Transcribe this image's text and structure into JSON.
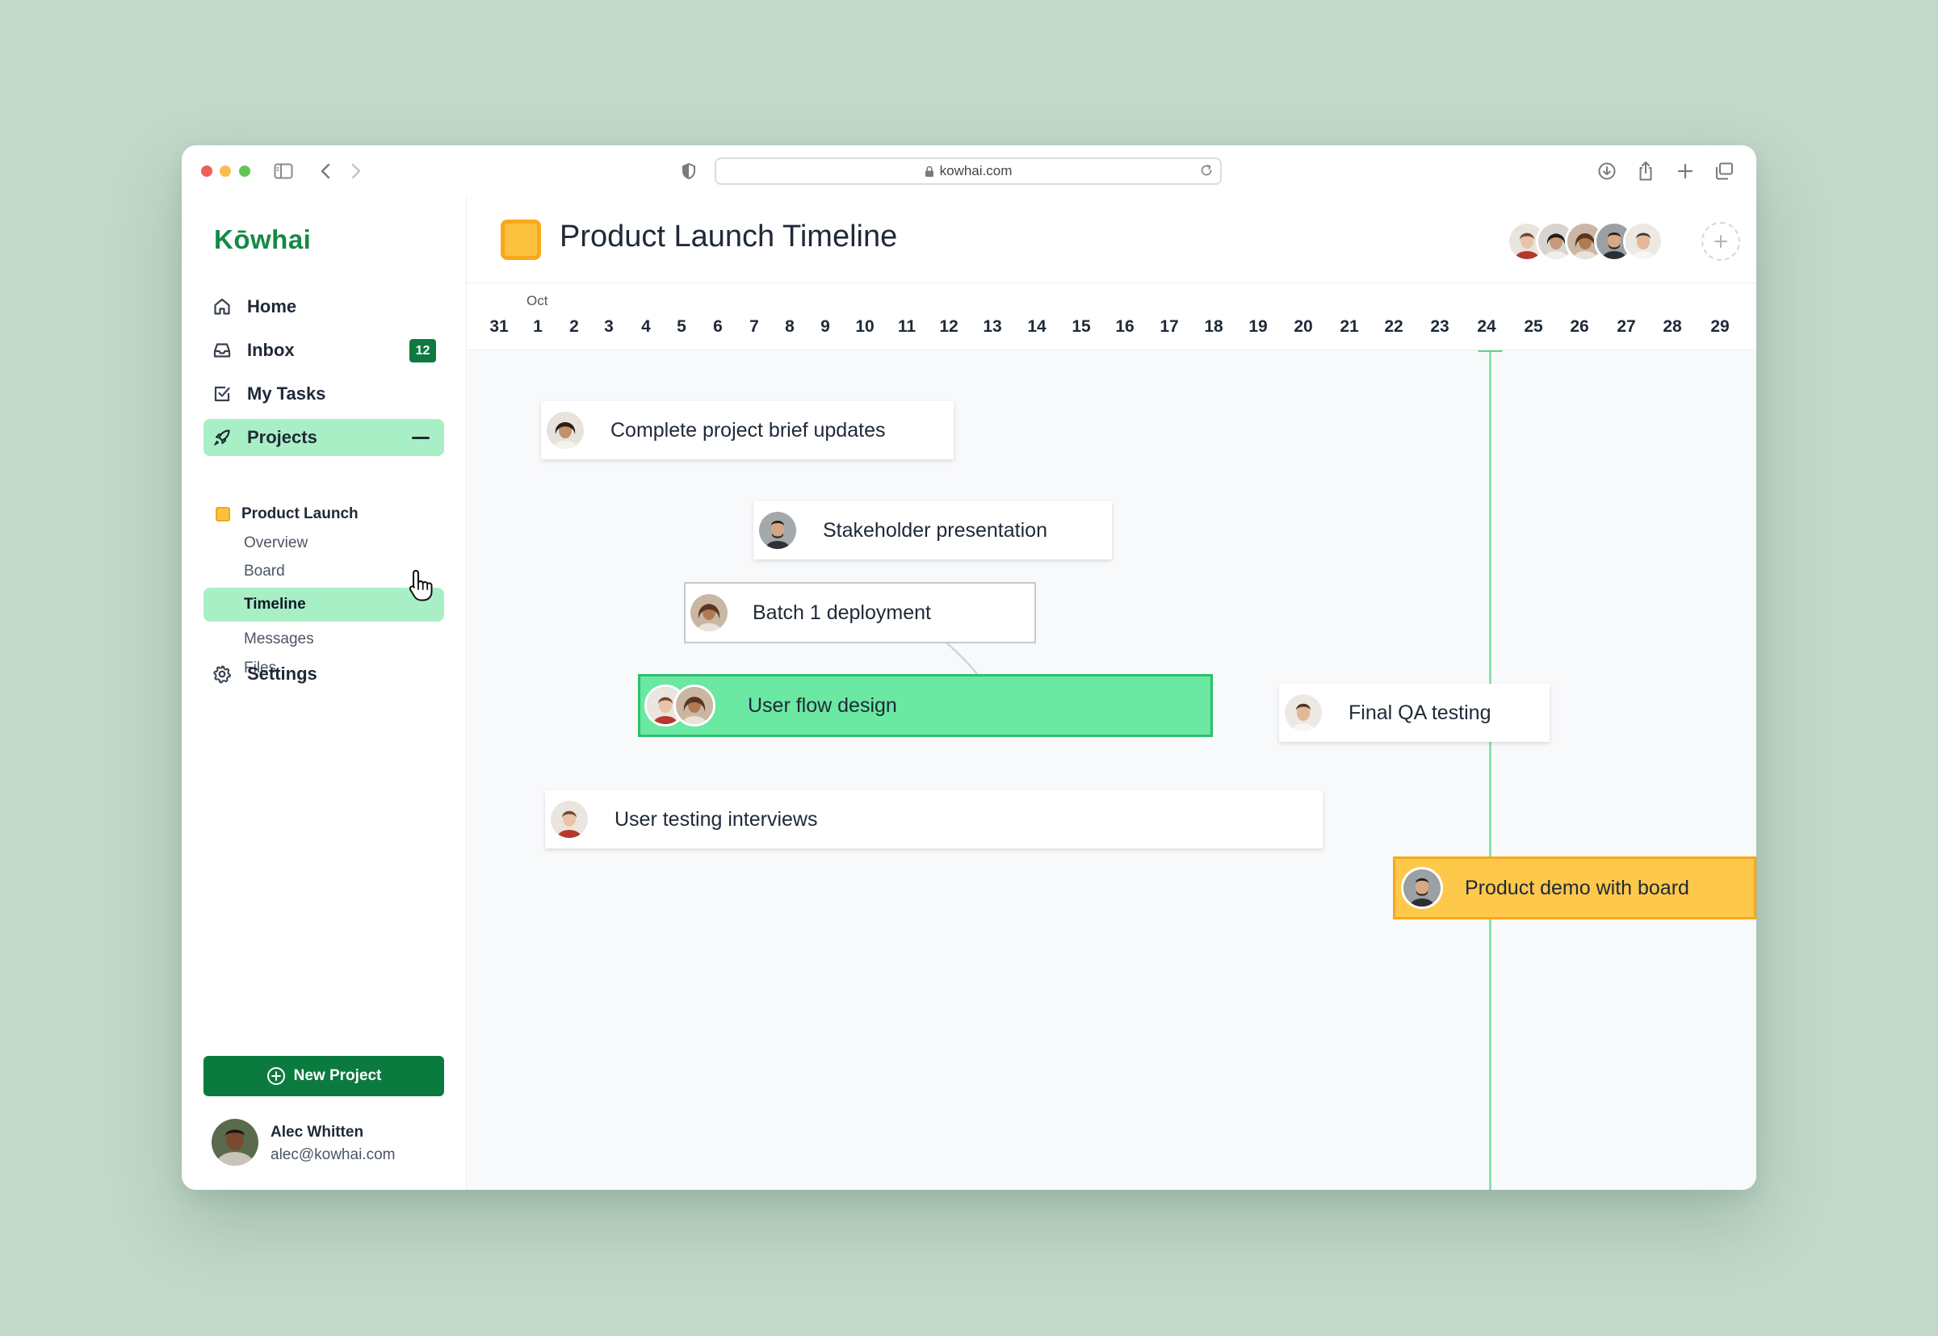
{
  "browser": {
    "url": "kowhai.com"
  },
  "sidebar": {
    "brand": "Kōwhai",
    "nav": {
      "home": "Home",
      "inbox": "Inbox",
      "inbox_badge": "12",
      "my_tasks": "My Tasks",
      "projects": "Projects",
      "settings": "Settings"
    },
    "project": {
      "name": "Product Launch",
      "sub_items": [
        "Overview",
        "Board",
        "Timeline",
        "Messages",
        "Files"
      ],
      "active_sub_item": "Timeline"
    },
    "new_project_label": "New Project",
    "user": {
      "name": "Alec Whitten",
      "email": "alec@kowhai.com"
    }
  },
  "header": {
    "title": "Product Launch Timeline"
  },
  "timeline": {
    "month_label": "Oct",
    "days": [
      "31",
      "1",
      "2",
      "3",
      "4",
      "5",
      "6",
      "7",
      "8",
      "9",
      "10",
      "11",
      "12",
      "13",
      "14",
      "15",
      "16",
      "17",
      "18",
      "19",
      "20",
      "21",
      "22",
      "23",
      "24",
      "25",
      "26",
      "27",
      "28",
      "29"
    ],
    "today": "24",
    "tasks": [
      {
        "label": "Complete project brief updates",
        "style": "default"
      },
      {
        "label": "Stakeholder presentation",
        "style": "default"
      },
      {
        "label": "User flow design",
        "style": "green"
      },
      {
        "label": "Batch 1 deployment",
        "style": "outlined"
      },
      {
        "label": "Final QA testing",
        "style": "default"
      },
      {
        "label": "User testing interviews",
        "style": "default"
      },
      {
        "label": "Product demo with board",
        "style": "yellow"
      }
    ],
    "dependency": {
      "from": "Batch 1 deployment",
      "to": "Final QA testing"
    }
  },
  "colors": {
    "background": "#c2d8ca",
    "brand": "#138a45",
    "accent_green": "#a9efc6",
    "task_green": "#6be8a2",
    "task_yellow": "#fec84b",
    "today_line": "#86e6aa",
    "primary_button": "#0b7a3e"
  }
}
